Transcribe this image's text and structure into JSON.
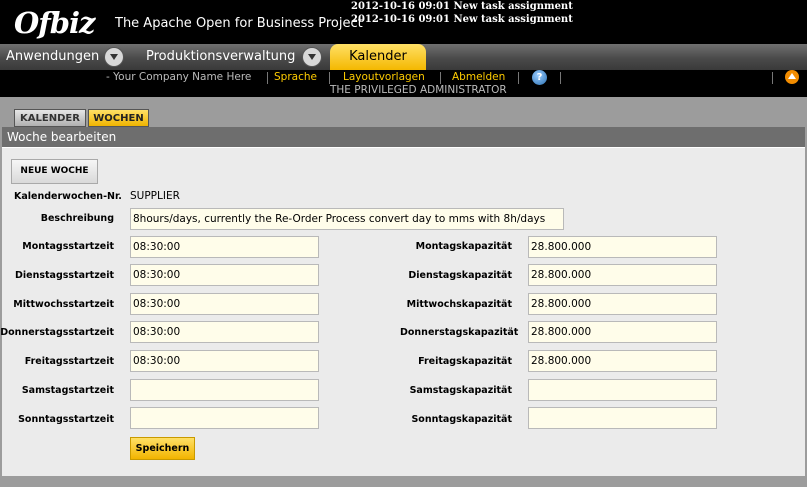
{
  "header": {
    "logo_text": "Ofbiz",
    "app_title": "The Apache Open for Business Project",
    "notices": [
      "2012-10-16 09:01 New task assignment",
      "2012-10-16 09:01 New task assignment"
    ]
  },
  "appbar": {
    "tabs": [
      "Anwendungen",
      "Produktionsverwaltung"
    ],
    "active_tab": "Kalender"
  },
  "userbar": {
    "company": "- Your Company Name Here",
    "links": [
      "Sprache",
      "Layoutvorlagen",
      "Abmelden"
    ],
    "admin": "THE PRIVILEGED ADMINISTRATOR",
    "help_icon": "?"
  },
  "subtabs": {
    "kalender": "KALENDER",
    "wochen": "WOCHEN"
  },
  "screenlet": {
    "title": "Woche bearbeiten"
  },
  "form": {
    "new_button": "NEUE WOCHE",
    "calendar_week_label": "Kalenderwochen-Nr.",
    "calendar_week_value": "SUPPLIER",
    "description_label": "Beschreibung",
    "description_value": "8hours/days, currently the Re-Order Process convert day to mms with 8h/days",
    "days": [
      {
        "start_label": "Montagsstartzeit",
        "start_value": "08:30:00",
        "cap_label": "Montagskapazität",
        "cap_value": "28.800.000"
      },
      {
        "start_label": "Dienstagsstartzeit",
        "start_value": "08:30:00",
        "cap_label": "Dienstagskapazität",
        "cap_value": "28.800.000"
      },
      {
        "start_label": "Mittwochsstartzeit",
        "start_value": "08:30:00",
        "cap_label": "Mittwochskapazität",
        "cap_value": "28.800.000"
      },
      {
        "start_label": "Donnerstagsstartzeit",
        "start_value": "08:30:00",
        "cap_label": "Donnerstagskapazität",
        "cap_value": "28.800.000"
      },
      {
        "start_label": "Freitagsstartzeit",
        "start_value": "08:30:00",
        "cap_label": "Freitagskapazität",
        "cap_value": "28.800.000"
      },
      {
        "start_label": "Samstagstartzeit",
        "start_value": "",
        "cap_label": "Samstagskapazität",
        "cap_value": ""
      },
      {
        "start_label": "Sonntagsstartzeit",
        "start_value": "",
        "cap_label": "Sonntagskapazität",
        "cap_value": ""
      }
    ],
    "save_button": "Speichern"
  },
  "colors": {
    "accent": "#f4b800",
    "header_bg": "#000000",
    "input_bg": "#fffdea"
  }
}
